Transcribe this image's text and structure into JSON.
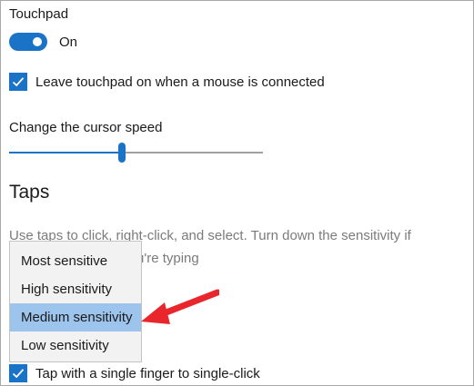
{
  "touchpad": {
    "label": "Touchpad",
    "toggle_state": "On"
  },
  "leave_on": {
    "checked": true,
    "label": "Leave touchpad on when a mouse is connected"
  },
  "cursor_speed": {
    "label": "Change the cursor speed",
    "value_fraction": 0.44
  },
  "taps": {
    "heading": "Taps",
    "description_line1": "Use taps to click, right-click, and select. Turn down the sensitivity if",
    "description_line2": "u're typing"
  },
  "sensitivity_dropdown": {
    "options": [
      "Most sensitive",
      "High sensitivity",
      "Medium sensitivity",
      "Low sensitivity"
    ],
    "selected": "Medium sensitivity"
  },
  "single_tap": {
    "checked": true,
    "label": "Tap with a single finger to single-click"
  },
  "colors": {
    "accent": "#1a73c7",
    "selection": "#9dc4ec",
    "annotation_arrow": "#e8262b"
  }
}
